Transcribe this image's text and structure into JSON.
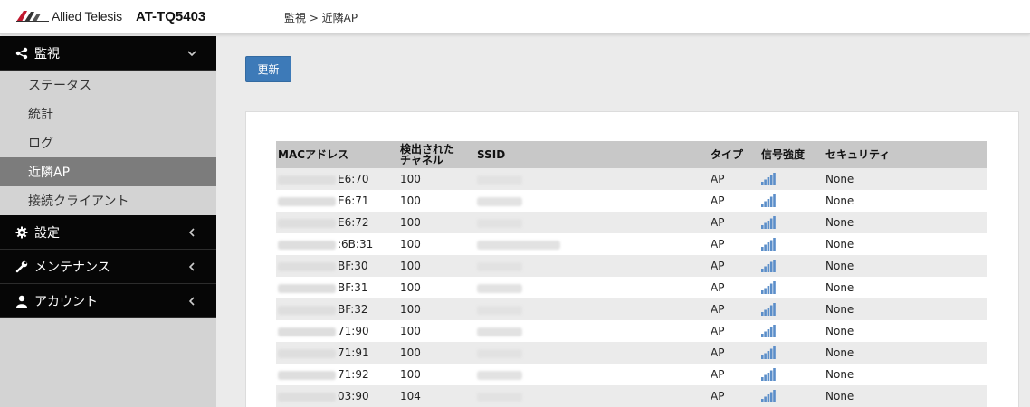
{
  "header": {
    "brand": "Allied Telesis",
    "model": "AT-TQ5403",
    "breadcrumb": "監視 > 近隣AP"
  },
  "sidebar": {
    "groups": [
      {
        "label": "監視",
        "icon": "share-icon",
        "expanded": true,
        "items": [
          {
            "label": "ステータス",
            "active": false
          },
          {
            "label": "統計",
            "active": false
          },
          {
            "label": "ログ",
            "active": false
          },
          {
            "label": "近隣AP",
            "active": true
          },
          {
            "label": "接続クライアント",
            "active": false
          }
        ]
      },
      {
        "label": "設定",
        "icon": "gear-icon",
        "expanded": false
      },
      {
        "label": "メンテナンス",
        "icon": "wrench-icon",
        "expanded": false
      },
      {
        "label": "アカウント",
        "icon": "user-icon",
        "expanded": false
      }
    ]
  },
  "main": {
    "refresh_label": "更新",
    "table": {
      "headers": {
        "mac": "MACアドレス",
        "channel_line1": "検出された",
        "channel_line2": "チャネル",
        "ssid": "SSID",
        "type": "タイプ",
        "signal": "信号強度",
        "security": "セキュリティ"
      },
      "rows": [
        {
          "mac_suffix": "E6:70",
          "channel": "100",
          "type": "AP",
          "security": "None"
        },
        {
          "mac_suffix": "E6:71",
          "channel": "100",
          "type": "AP",
          "security": "None"
        },
        {
          "mac_suffix": "E6:72",
          "channel": "100",
          "type": "AP",
          "security": "None"
        },
        {
          "mac_suffix": ":6B:31",
          "channel": "100",
          "type": "AP",
          "security": "None"
        },
        {
          "mac_suffix": "BF:30",
          "channel": "100",
          "type": "AP",
          "security": "None"
        },
        {
          "mac_suffix": "BF:31",
          "channel": "100",
          "type": "AP",
          "security": "None"
        },
        {
          "mac_suffix": "BF:32",
          "channel": "100",
          "type": "AP",
          "security": "None"
        },
        {
          "mac_suffix": "71:90",
          "channel": "100",
          "type": "AP",
          "security": "None"
        },
        {
          "mac_suffix": "71:91",
          "channel": "100",
          "type": "AP",
          "security": "None"
        },
        {
          "mac_suffix": "71:92",
          "channel": "100",
          "type": "AP",
          "security": "None"
        },
        {
          "mac_suffix": "03:90",
          "channel": "104",
          "type": "AP",
          "security": "None"
        }
      ]
    }
  },
  "colors": {
    "accent": "#3d7ab8",
    "signal_bar": "#5b8ec9",
    "sidebar_group_bg": "#060606",
    "sidebar_active_bg": "#7c7c7c"
  }
}
